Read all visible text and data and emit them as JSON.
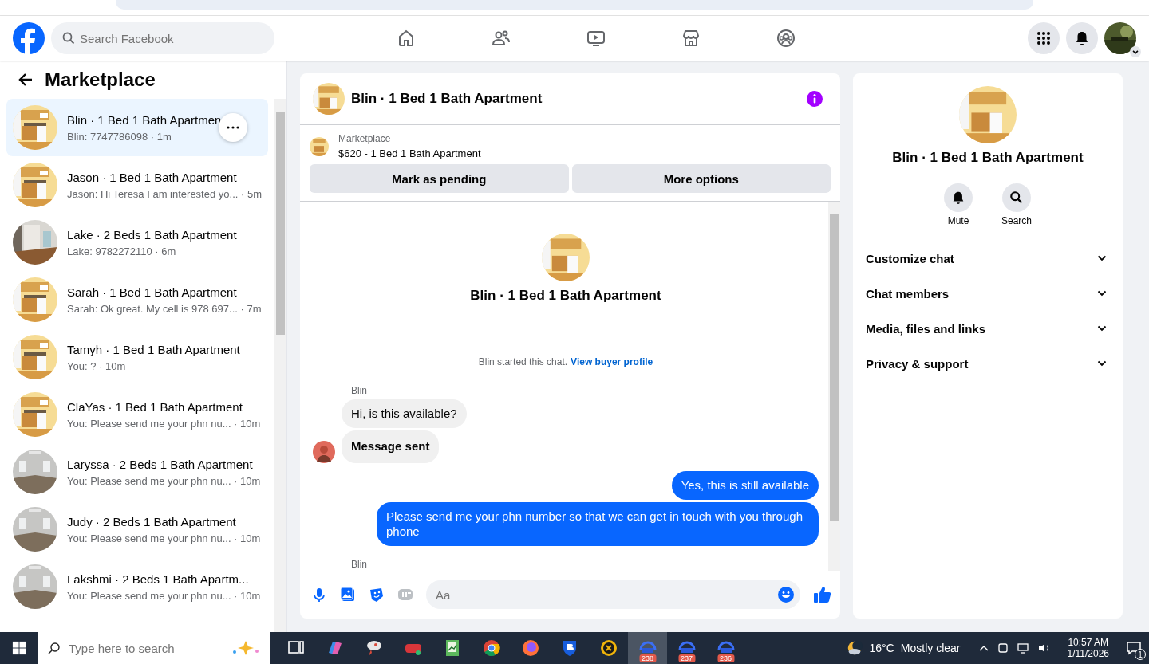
{
  "header": {
    "search": {
      "placeholder": "Search Facebook"
    }
  },
  "sidebar": {
    "title": "Marketplace",
    "conversations": [
      {
        "title": "Blin · 1 Bed 1 Bath Apartmen",
        "preview": "Blin: 7747786098 · 1m",
        "selected": true
      },
      {
        "title": "Jason · 1 Bed 1 Bath Apartment",
        "preview": "Jason: Hi Teresa I am interested yo... · 5m",
        "selected": false
      },
      {
        "title": "Lake · 2 Beds 1 Bath Apartment",
        "preview": "Lake: 9782272110 · 6m",
        "selected": false
      },
      {
        "title": "Sarah · 1 Bed 1 Bath Apartment",
        "preview": "Sarah: Ok great. My cell is 978 697... · 7m",
        "selected": false
      },
      {
        "title": "Tamyh · 1 Bed 1 Bath Apartment",
        "preview": "You: ? · 10m",
        "selected": false
      },
      {
        "title": "ClaYas · 1 Bed 1 Bath Apartment",
        "preview": "You: Please send me your phn nu... · 10m",
        "selected": false
      },
      {
        "title": "Laryssa · 2 Beds 1 Bath Apartment",
        "preview": "You: Please send me your phn nu... · 10m",
        "selected": false
      },
      {
        "title": "Judy · 2 Beds 1 Bath Apartment",
        "preview": "You: Please send me your phn nu... · 10m",
        "selected": false
      },
      {
        "title": "Lakshmi · 2 Beds 1 Bath Apartm...",
        "preview": "You: Please send me your phn nu... · 10m",
        "selected": false
      }
    ]
  },
  "chat": {
    "title": "Blin · 1 Bed 1 Bath Apartment",
    "listing": {
      "label": "Marketplace",
      "text": "$620 - 1 Bed 1 Bath Apartment"
    },
    "buttons": [
      "Mark as pending",
      "More options"
    ],
    "intro": {
      "name": "Blin · 1 Bed 1 Bath Apartment",
      "started": "Blin started this chat.",
      "link": "View buyer profile"
    },
    "messages": [
      {
        "kind": "sender",
        "text": "Blin"
      },
      {
        "kind": "incoming",
        "text": "Hi, is this available?",
        "bold": false,
        "avatar": false
      },
      {
        "kind": "incoming",
        "text": "Message sent",
        "bold": true,
        "avatar": true
      },
      {
        "kind": "outgoing",
        "text": "Yes, this is still available"
      },
      {
        "kind": "outgoing",
        "text": "Please send me your phn number so that we can get in touch with you through phone"
      },
      {
        "kind": "sender",
        "text": "Blin"
      }
    ],
    "composer": {
      "placeholder": "Aa"
    }
  },
  "details": {
    "name": "Blin · 1 Bed 1 Bath Apartment",
    "actions": [
      {
        "kind": "mute",
        "label": "Mute"
      },
      {
        "kind": "search",
        "label": "Search"
      }
    ],
    "sections": [
      "Customize chat",
      "Chat members",
      "Media, files and links",
      "Privacy & support"
    ]
  },
  "taskbar": {
    "search": {
      "placeholder": "Type here to search"
    },
    "apps": [
      {
        "kind": "taskview",
        "selected": false
      },
      {
        "kind": "copilot",
        "selected": false
      },
      {
        "kind": "brush",
        "selected": false
      },
      {
        "kind": "redapp",
        "selected": false
      },
      {
        "kind": "notepad",
        "selected": false
      },
      {
        "kind": "chrome",
        "selected": false
      },
      {
        "kind": "firefox",
        "selected": false
      },
      {
        "kind": "shield",
        "selected": false
      },
      {
        "kind": "xcircle",
        "selected": false
      },
      {
        "kind": "mail",
        "badge": "238",
        "selected": true
      },
      {
        "kind": "mail",
        "badge": "237",
        "selected": false
      },
      {
        "kind": "mail",
        "badge": "236",
        "selected": false
      }
    ],
    "weather": {
      "temp": "16°C",
      "text": "Mostly clear"
    },
    "time": "10:57 AM",
    "date": "1/11/2026",
    "notifications": "1"
  }
}
